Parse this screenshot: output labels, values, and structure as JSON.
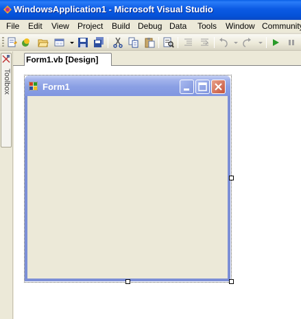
{
  "window": {
    "title": "WindowsApplication1 - Microsoft Visual Studio"
  },
  "menu": {
    "items": [
      {
        "label": "File"
      },
      {
        "label": "Edit"
      },
      {
        "label": "View"
      },
      {
        "label": "Project"
      },
      {
        "label": "Build"
      },
      {
        "label": "Debug"
      },
      {
        "label": "Data"
      },
      {
        "label": "Tools"
      },
      {
        "label": "Window"
      },
      {
        "label": "Community"
      }
    ]
  },
  "toolbar": {
    "buttons": [
      "new-project-icon",
      "add-item-icon",
      "open-file-icon",
      "add-new-item-icon",
      "save-icon",
      "save-all-icon",
      "cut-icon",
      "copy-icon",
      "paste-icon",
      "find-icon",
      "comment-icon",
      "uncomment-icon",
      "undo-icon",
      "redo-icon",
      "start-debugging-icon",
      "pause-icon"
    ]
  },
  "toolbox": {
    "label": "Toolbox"
  },
  "tabs": {
    "active_label": "Form1.vb [Design]"
  },
  "form": {
    "title": "Form1",
    "back_color": "#ece9d8"
  },
  "colors": {
    "title_bar": "#0a5fe6",
    "form_border": "#7c8fd6",
    "close_button": "#c5543a"
  }
}
